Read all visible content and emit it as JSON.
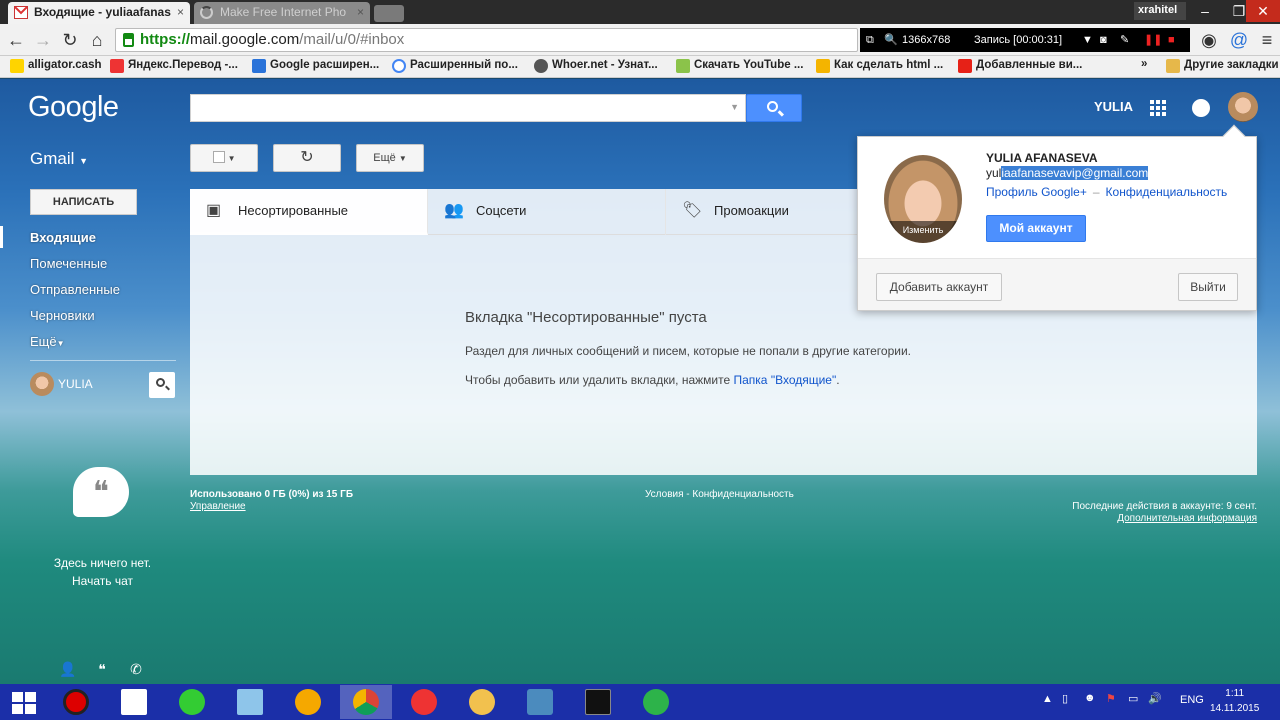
{
  "browser": {
    "tabs": [
      {
        "title": "Входящие - yuliaafanas",
        "active": true
      },
      {
        "title": "Make Free Internet Pho",
        "active": false
      }
    ],
    "window_user": "xrahitel",
    "url_https": "https://",
    "url_host": "mail.google.com",
    "url_path": "/mail/u/0/#inbox",
    "recorder": {
      "resolution": "1366x768",
      "status": "Запись [00:00:31]"
    },
    "bookmarks": [
      {
        "label": "alligator.cash",
        "icon": "lightning-icon"
      },
      {
        "label": "Яндекс.Перевод -...",
        "icon": "yandex-icon"
      },
      {
        "label": "Google расширен...",
        "icon": "ih-icon"
      },
      {
        "label": "Расширенный по...",
        "icon": "google-icon"
      },
      {
        "label": "Whoer.net - Узнат...",
        "icon": "whoer-icon"
      },
      {
        "label": "Скачать YouTube ...",
        "icon": "download-icon"
      },
      {
        "label": "Как сделать html ...",
        "icon": "arrow-icon"
      },
      {
        "label": "Добавленные ви...",
        "icon": "youtube-icon"
      }
    ],
    "bookmarks_more": "»",
    "other_bookmarks": "Другие закладки"
  },
  "gmail": {
    "logo": "Google",
    "username": "YULIA",
    "app_label": "Gmail",
    "toolbar": {
      "more": "Ещё"
    },
    "compose": "НАПИСАТЬ",
    "nav": [
      "Входящие",
      "Помеченные",
      "Отправленные",
      "Черновики",
      "Ещё"
    ],
    "side_user": "YULIA",
    "hangouts_empty": "Здесь ничего нет.",
    "hangouts_start": "Начать чат",
    "tabs": [
      "Несортированные",
      "Соцсети",
      "Промоакции"
    ],
    "empty": {
      "title": "Вкладка \"Несортированные\" пуста",
      "desc": "Раздел для личных сообщений и писем, которые не попали в другие категории.",
      "hint_prefix": "Чтобы добавить или удалить вкладки, нажмите ",
      "hint_link": "Папка \"Входящие\"",
      "hint_suffix": "."
    },
    "footer": {
      "usage": "Использовано 0 ГБ (0%) из 15 ГБ",
      "manage": "Управление",
      "terms": "Условия - Конфиденциальность",
      "last_activity": "Последние действия в аккаунте: 9 сент.",
      "more_info": "Дополнительная информация"
    }
  },
  "account_popup": {
    "name": "YULIA AFANASEVA",
    "email_prefix": "yul",
    "email_selected": "iaafanasevavip@gmail.com",
    "change_photo": "Изменить",
    "link_profile": "Профиль Google+",
    "link_separator": "–",
    "link_privacy": "Конфиденциальность",
    "my_account": "Мой аккаунт",
    "add_account": "Добавить аккаунт",
    "sign_out": "Выйти"
  },
  "taskbar": {
    "lang": "ENG",
    "time": "1:11",
    "date": "14.11.2015"
  },
  "colors": {
    "accent": "#4d90fe",
    "link": "#1155cc",
    "taskbar": "#1b2fa8"
  }
}
